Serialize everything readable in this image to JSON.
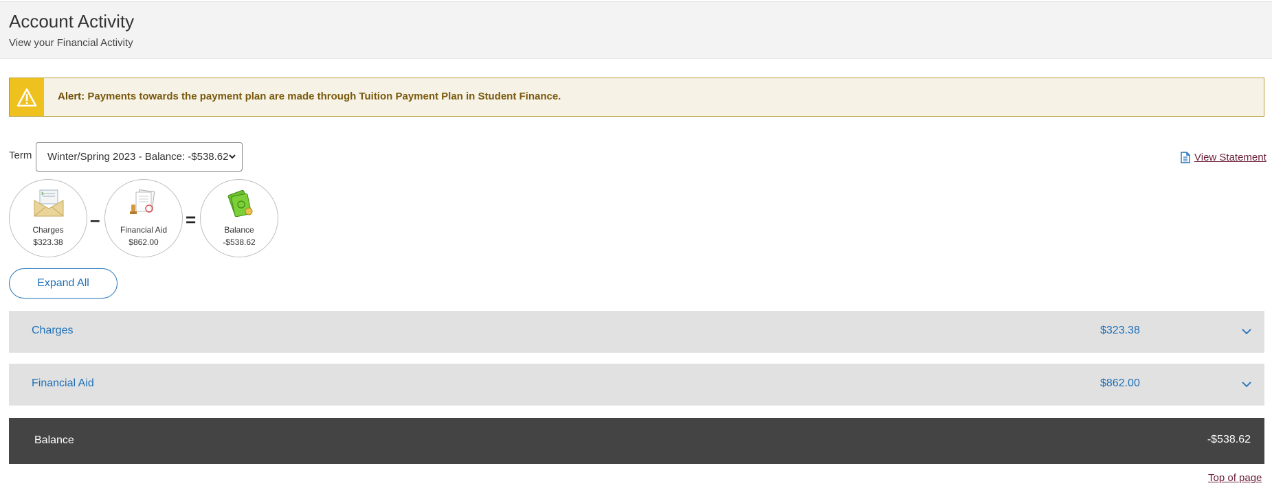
{
  "header": {
    "title": "Account Activity",
    "subtitle": "View your Financial Activity"
  },
  "alert": {
    "prefix": "Alert:",
    "message": "Payments towards the payment plan are made through Tuition Payment Plan in Student Finance.",
    "icon": "warning-icon",
    "colors": {
      "icon_bg": "#efc11e",
      "bg": "#f6f2e6",
      "border": "#b89a32",
      "text": "#7a5a0e"
    }
  },
  "term": {
    "label": "Term",
    "selected": "Winter/Spring 2023 - Balance: -$538.62"
  },
  "view_statement": {
    "label": "View Statement",
    "icon": "document-icon"
  },
  "summary": {
    "charges": {
      "label": "Charges",
      "value": "$323.38",
      "icon": "envelope-bill-icon"
    },
    "operator_minus": "–",
    "financial_aid": {
      "label": "Financial Aid",
      "value": "$862.00",
      "icon": "documents-stamp-icon"
    },
    "operator_equals": "=",
    "balance": {
      "label": "Balance",
      "value": "-$538.62",
      "icon": "money-icon"
    }
  },
  "expand_all": {
    "label": "Expand All"
  },
  "sections": [
    {
      "label": "Charges",
      "amount": "$323.38",
      "icon": "chevron-down-icon"
    },
    {
      "label": "Financial Aid",
      "amount": "$862.00",
      "icon": "chevron-down-icon"
    }
  ],
  "balance_bar": {
    "label": "Balance",
    "amount": "-$538.62"
  },
  "top_of_page": {
    "label": "Top of page"
  },
  "colors": {
    "link_blue": "#1e6fb8",
    "link_maroon": "#6b1f3a",
    "accordion_bg": "#e1e1e1",
    "balance_bg": "#444444"
  }
}
